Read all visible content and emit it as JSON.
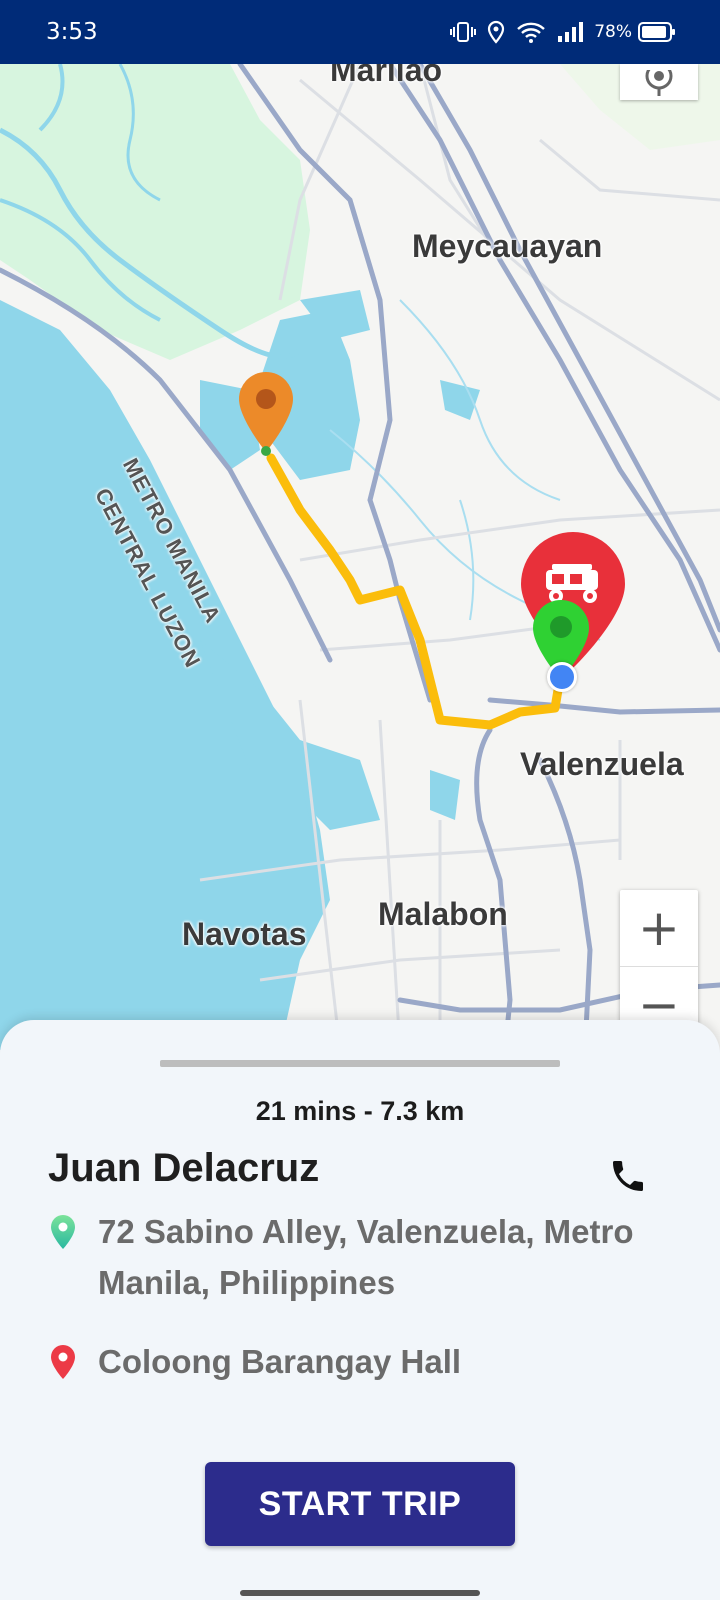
{
  "status_bar": {
    "time": "3:53",
    "battery": "78%",
    "icons": [
      "vibrate-icon",
      "location-icon",
      "wifi-icon",
      "signal-icon",
      "battery-icon"
    ]
  },
  "map": {
    "labels": {
      "marilao": "Marilao",
      "meycauayan": "Meycauayan",
      "metro_manila": "METRO MANILA",
      "central_luzon": "CENTRAL LUZON",
      "valenzuela": "Valenzuela",
      "malabon": "Malabon",
      "navotas": "Navotas"
    },
    "zoom_in": "+",
    "zoom_out": "−",
    "route_color": "#fbbd0b",
    "water_color": "#8fd6ea",
    "park_color": "#d7f5df"
  },
  "trip": {
    "eta": "21 mins - 7.3 km",
    "passenger_name": "Juan Delacruz",
    "pickup_address": "72 Sabino Alley, Valenzuela, Metro Manila, Philippines",
    "destination": "Coloong Barangay Hall",
    "start_button": "START TRIP"
  }
}
